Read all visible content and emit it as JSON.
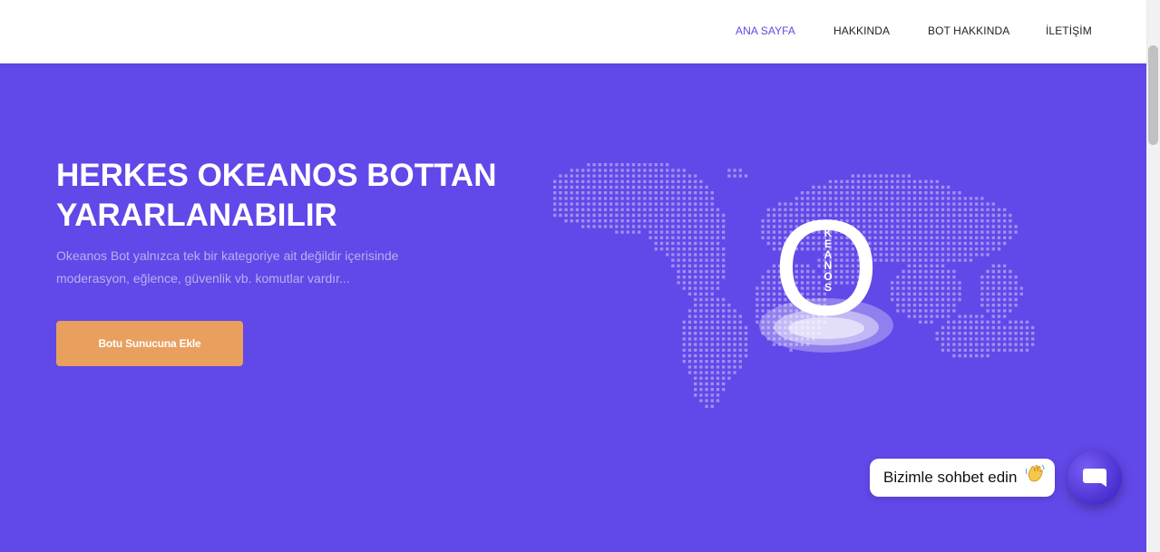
{
  "nav": {
    "items": [
      {
        "label": "ANA SAYFA",
        "active": true
      },
      {
        "label": "HAKKINDA",
        "active": false
      },
      {
        "label": "BOT HAKKINDA",
        "active": false
      },
      {
        "label": "İLETİŞİM",
        "active": false
      }
    ],
    "active_color": "#6148e8"
  },
  "hero": {
    "title_line1": "HERKES OKEANOS BOTTAN",
    "title_line2": "YARARLANABILIR",
    "description_line1": "Okeanos Bot yalnızca tek bir kategoriye ait değildir içerisinde",
    "description_line2": "moderasyon, eğlence, güvenlik vb. komutlar vardır...",
    "cta_label": "Botu Sunucuna Ekle",
    "background_color": "#6148e8",
    "cta_color": "#e99f5d"
  },
  "logo": {
    "big_letter": "O",
    "vertical_letters": [
      "K",
      "E",
      "A",
      "N",
      "O",
      "S"
    ]
  },
  "chat": {
    "bubble_text": "Bizimle sohbet edin",
    "wave_icon": "waving-hand-icon",
    "button_icon": "chat-icon"
  }
}
